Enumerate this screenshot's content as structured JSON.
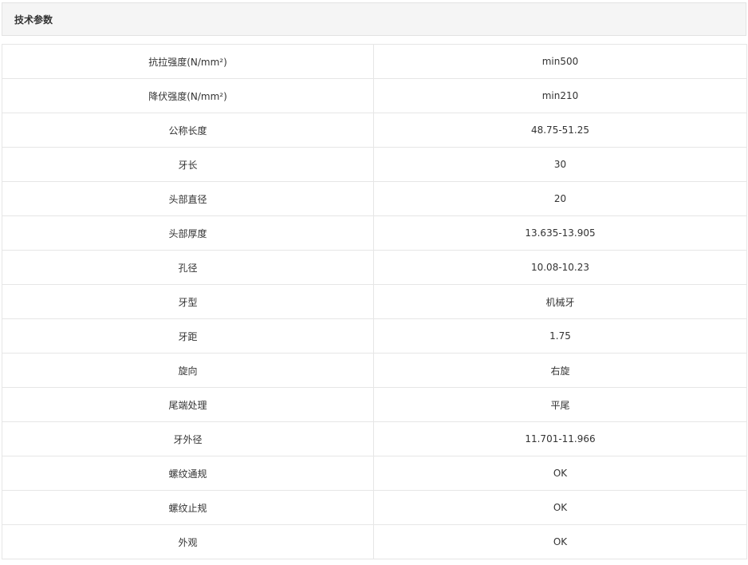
{
  "section": {
    "title": "技术参数"
  },
  "params": [
    {
      "name": "抗拉强度(N/mm²)",
      "value": "min500"
    },
    {
      "name": "降伏强度(N/mm²)",
      "value": "min210"
    },
    {
      "name": "公称长度",
      "value": "48.75-51.25"
    },
    {
      "name": "牙长",
      "value": "30"
    },
    {
      "name": "头部直径",
      "value": "20"
    },
    {
      "name": "头部厚度",
      "value": "13.635-13.905"
    },
    {
      "name": "孔径",
      "value": "10.08-10.23"
    },
    {
      "name": "牙型",
      "value": "机械牙"
    },
    {
      "name": "牙距",
      "value": "1.75"
    },
    {
      "name": "旋向",
      "value": "右旋"
    },
    {
      "name": "尾端处理",
      "value": "平尾"
    },
    {
      "name": "牙外径",
      "value": "11.701-11.966"
    },
    {
      "name": "螺纹通规",
      "value": "OK"
    },
    {
      "name": "螺纹止规",
      "value": "OK"
    },
    {
      "name": "外观",
      "value": "OK"
    }
  ],
  "colors": {
    "header_bg": "#f5f5f5",
    "border": "#e6e6e6",
    "text": "#333333"
  }
}
